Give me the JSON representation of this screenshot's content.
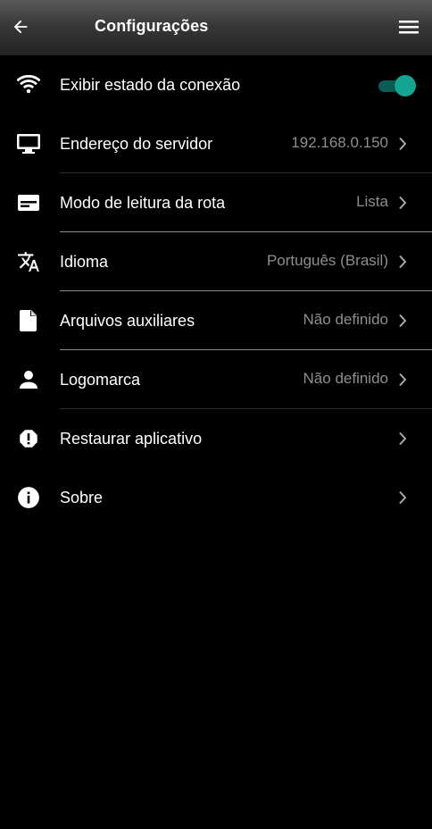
{
  "toolbar": {
    "title": "Configurações",
    "back_icon": "arrow-left-icon",
    "menu_icon": "hamburger-menu-icon"
  },
  "colors": {
    "toolbar_top": "#5a5a5a",
    "toolbar_bottom": "#222222",
    "background": "#000000",
    "accent": "#12a592",
    "secondary_text": "#8e8e8e"
  },
  "settings": {
    "items": [
      {
        "label": "Exibir estado da conexão",
        "icon": "wifi-icon",
        "toggle_on": true
      },
      {
        "label": "Endereço do servidor",
        "icon": "monitor-icon",
        "value": "192.168.0.150"
      },
      {
        "label": "Modo de leitura da rota",
        "icon": "card-icon",
        "value": "Lista"
      },
      {
        "label": "Idioma",
        "icon": "translate-icon",
        "value": "Português (Brasil)"
      },
      {
        "label": "Arquivos auxiliares",
        "icon": "file-icon",
        "value": "Não definido"
      },
      {
        "label": "Logomarca",
        "icon": "person-icon",
        "value": "Não definido"
      },
      {
        "label": "Restaurar aplicativo",
        "icon": "alert-icon"
      },
      {
        "label": "Sobre",
        "icon": "info-icon"
      }
    ]
  }
}
